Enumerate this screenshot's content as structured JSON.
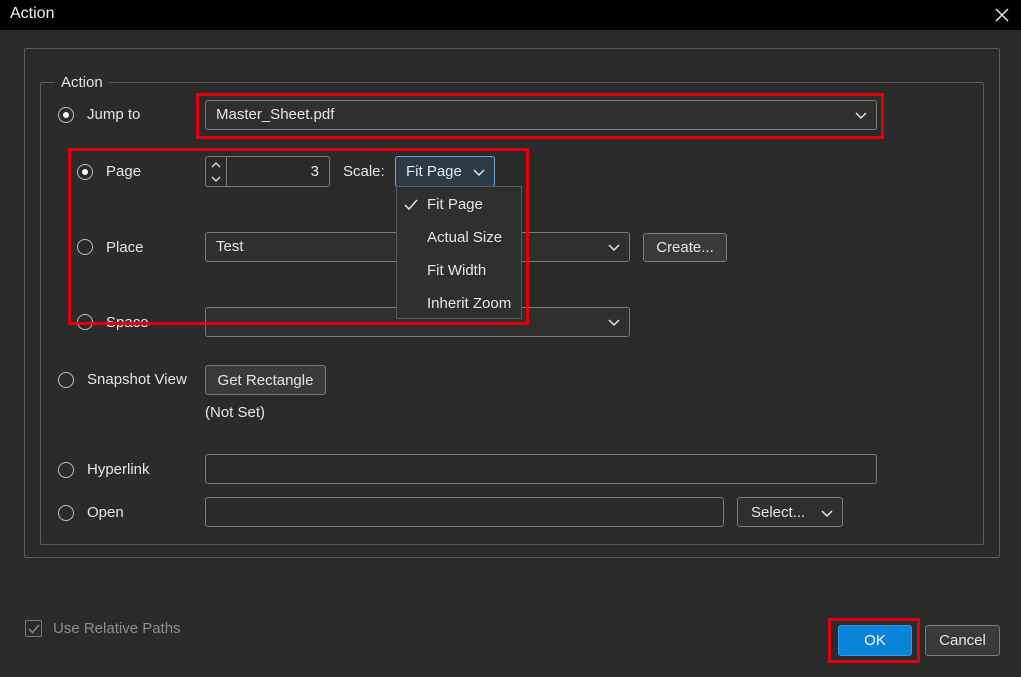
{
  "window": {
    "title": "Action"
  },
  "group": {
    "legend": "Action"
  },
  "jump_to": {
    "label": "Jump to",
    "file": "Master_Sheet.pdf"
  },
  "page": {
    "label": "Page",
    "value": "3",
    "scale_label": "Scale:",
    "scale_value": "Fit Page"
  },
  "scale_menu": {
    "items": [
      {
        "label": "Fit Page",
        "checked": true
      },
      {
        "label": "Actual Size",
        "checked": false
      },
      {
        "label": "Fit Width",
        "checked": false
      },
      {
        "label": "Inherit Zoom",
        "checked": false
      }
    ]
  },
  "place": {
    "label": "Place",
    "value": "Test",
    "create_button": "Create..."
  },
  "space": {
    "label": "Space",
    "value": ""
  },
  "snapshot": {
    "label": "Snapshot View",
    "button": "Get Rectangle",
    "status": "(Not Set)"
  },
  "hyperlink": {
    "label": "Hyperlink",
    "value": ""
  },
  "open": {
    "label": "Open",
    "value": "",
    "select_button": "Select..."
  },
  "footer": {
    "use_relative_paths": "Use Relative Paths",
    "ok": "OK",
    "cancel": "Cancel"
  },
  "colors": {
    "highlight": "#e0000a",
    "accent": "#0a84d8"
  }
}
